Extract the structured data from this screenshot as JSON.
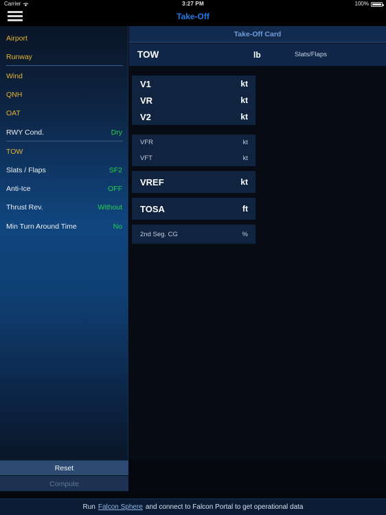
{
  "statusbar": {
    "carrier": "Carrier",
    "time": "3:27 PM",
    "battery": "100%"
  },
  "navbar": {
    "title": "Take-Off",
    "menu_icon": "hamburger-icon"
  },
  "sidebar": {
    "items": [
      {
        "label": "Airport",
        "value": "",
        "label_color": "#e8b430",
        "value_color": ""
      },
      {
        "label": "Runway",
        "value": "",
        "label_color": "#e8b430",
        "value_color": ""
      },
      {
        "label": "Wind",
        "value": "",
        "label_color": "#e8b430",
        "value_color": ""
      },
      {
        "label": "QNH",
        "value": "",
        "label_color": "#e8b430",
        "value_color": ""
      },
      {
        "label": "OAT",
        "value": "",
        "label_color": "#e8b430",
        "value_color": ""
      },
      {
        "label": "RWY Cond.",
        "value": "Dry",
        "label_color": "#eef2f6",
        "value_color": "#25d14a"
      },
      {
        "label": "TOW",
        "value": "",
        "label_color": "#e8b430",
        "value_color": ""
      },
      {
        "label": "Slats / Flaps",
        "value": "SF2",
        "label_color": "#eef2f6",
        "value_color": "#25d14a"
      },
      {
        "label": "Anti-Ice",
        "value": "OFF",
        "label_color": "#eef2f6",
        "value_color": "#25d14a"
      },
      {
        "label": "Thrust Rev.",
        "value": "Without",
        "label_color": "#eef2f6",
        "value_color": "#25d14a"
      },
      {
        "label": "Min Turn Around Time",
        "value": "No",
        "label_color": "#eef2f6",
        "value_color": "#25d14a"
      }
    ],
    "buttons": {
      "reset": "Reset",
      "compute": "Compute"
    }
  },
  "main": {
    "card_title": "Take-Off Card",
    "tow": {
      "label": "TOW",
      "unit": "lb",
      "slats_flaps": "Slats/Flaps"
    },
    "groups": [
      {
        "style": "big",
        "rows": [
          {
            "name": "V1",
            "unit": "kt"
          },
          {
            "name": "VR",
            "unit": "kt"
          },
          {
            "name": "V2",
            "unit": "kt"
          }
        ]
      },
      {
        "style": "small",
        "rows": [
          {
            "name": "VFR",
            "unit": "kt"
          },
          {
            "name": "VFT",
            "unit": "kt"
          }
        ]
      },
      {
        "style": "big",
        "rows": [
          {
            "name": "VREF",
            "unit": "kt"
          }
        ]
      },
      {
        "style": "big",
        "rows": [
          {
            "name": "TOSA",
            "unit": "ft"
          }
        ]
      },
      {
        "style": "small",
        "rows": [
          {
            "name": "2nd Seg. CG",
            "unit": "%"
          }
        ]
      }
    ],
    "runway_graphic": "runway-diagram"
  },
  "footer": {
    "prefix": "Run",
    "link": "Falcon Sphere",
    "suffix": "and connect to Falcon Portal to get operational data"
  },
  "colors": {
    "accent_blue": "#1f79e8",
    "label_yellow": "#e8b430",
    "value_green": "#25d14a",
    "card_bg": "#10233f",
    "header_text": "#6f9ddc"
  }
}
